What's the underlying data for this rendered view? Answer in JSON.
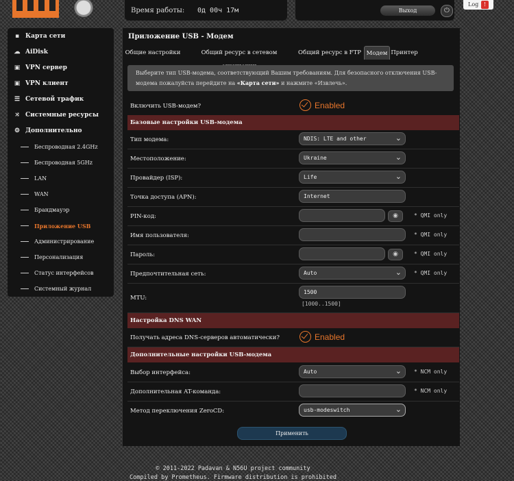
{
  "header": {
    "uptime_label": "Время работы:",
    "uptime_value": "0д 00ч 17м",
    "logout_label": "Выход",
    "log_label": "Log",
    "log_badge": "!"
  },
  "sidebar": {
    "items": [
      {
        "label": "Карта сети",
        "icon": "network-icon"
      },
      {
        "label": "AiDisk",
        "icon": "cloud-icon"
      },
      {
        "label": "VPN сервер",
        "icon": "vpn-server-icon"
      },
      {
        "label": "VPN клиент",
        "icon": "vpn-client-icon"
      },
      {
        "label": "Сетевой трафик",
        "icon": "traffic-icon"
      },
      {
        "label": "Системные ресурсы",
        "icon": "resources-icon"
      },
      {
        "label": "Дополнительно",
        "icon": "gear-icon"
      }
    ],
    "subitems": [
      {
        "label": "Беспроводная 2.4GHz"
      },
      {
        "label": "Беспроводная 5GHz"
      },
      {
        "label": "LAN"
      },
      {
        "label": "WAN"
      },
      {
        "label": "Брандмауэр"
      },
      {
        "label": "Приложение USB",
        "active": true
      },
      {
        "label": "Администрирование"
      },
      {
        "label": "Персонализация"
      },
      {
        "label": "Статус интерфейсов"
      },
      {
        "label": "Системный журнал"
      }
    ]
  },
  "main": {
    "title": "Приложение USB - Модем",
    "tabs": [
      {
        "label": "Общие настройки"
      },
      {
        "label": "Общий ресурс в сетевом окружении"
      },
      {
        "label": "Общий ресурс в FTP"
      },
      {
        "label": "Модем",
        "active": true
      },
      {
        "label": "Принтер"
      }
    ],
    "info_part1": "Выберите тип USB-модема, соответствующий Вашим требованиям. Для безопасного отключения USB-модема пожалуйста перейдите на ",
    "info_link": "«Карта сети»",
    "info_part2": " и нажмите «Извлечь».",
    "enable_modem_label": "Включить USB-модем?",
    "enabled_text": "Enabled",
    "section_basic": "Базовые настройки USB-модема",
    "modem_type_label": "Тип модема:",
    "modem_type_value": "NDIS: LTE and other",
    "location_label": "Местоположение:",
    "location_value": "Ukraine",
    "isp_label": "Провайдер (ISP):",
    "isp_value": "Life",
    "apn_label": "Точка доступа (APN):",
    "apn_value": "Internet",
    "pin_label": "PIN-код:",
    "pin_value": "",
    "username_label": "Имя пользователя:",
    "username_value": "",
    "password_label": "Пароль:",
    "password_value": "",
    "pref_net_label": "Предпочтительная сеть:",
    "pref_net_value": "Auto",
    "mtu_label": "MTU:",
    "mtu_value": "1500",
    "mtu_hint": "[1000..1500]",
    "qmi_note": "* QMI only",
    "section_dns": "Настройка DNS WAN",
    "dns_auto_label": "Получать адреса DNS-серверов автоматически?",
    "section_extra": "Дополнительные настройки USB-модема",
    "iface_label": "Выбор интерфейса:",
    "iface_value": "Auto",
    "ncm_note": "* NCM only",
    "at_label": "Дополнительная AT-команда:",
    "at_value": "",
    "zerocd_label": "Метод переключения ZeroCD:",
    "zerocd_value": "usb-modeswitch",
    "apply_label": "Применить"
  },
  "footer": {
    "line1": "© 2011-2022 Padavan & N56U project community",
    "line2": "Compiled by Prometheus. Firmware distribution is prohibited"
  },
  "colors": {
    "accent": "#e8762c",
    "section_bg": "#5a2222",
    "apply_bg": "#1d3950"
  }
}
